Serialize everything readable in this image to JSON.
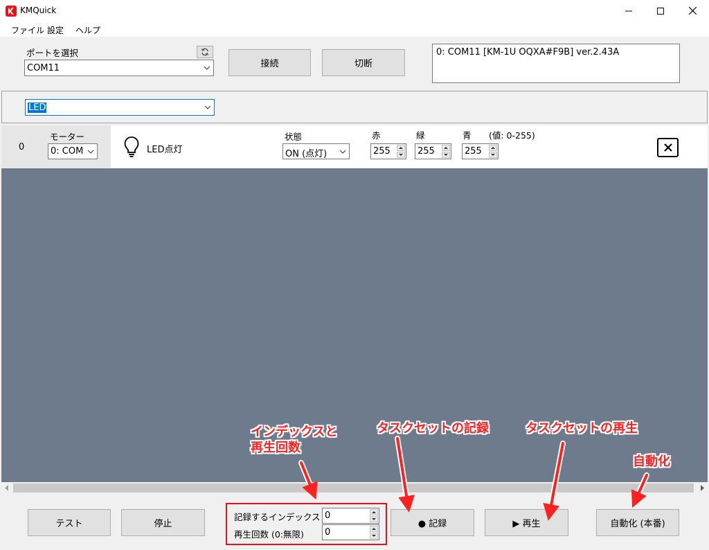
{
  "window": {
    "title": "KMQuick"
  },
  "menu": {
    "items": [
      "ファイル",
      "設定",
      "ヘルプ"
    ]
  },
  "port": {
    "label": "ポートを選択",
    "selected": "COM11",
    "connect_label": "接続",
    "disconnect_label": "切断"
  },
  "device_info": "0: COM11 [KM-1U OQXA#F9B] ver.2.43A",
  "task_type": {
    "selected": "LED"
  },
  "task_row": {
    "index": "0",
    "motor_label": "モーター",
    "motor_value": "0: COM",
    "action_label": "LED点灯",
    "state_label": "状態",
    "state_value": "ON (点灯)",
    "red_label": "赤",
    "green_label": "緑",
    "blue_label": "青",
    "range_note": "(値: 0-255)",
    "red_value": "255",
    "green_value": "255",
    "blue_value": "255"
  },
  "bottom": {
    "test_label": "テスト",
    "stop_label": "停止",
    "record_index_label": "記録するインデックス",
    "record_index_value": "0",
    "repeat_label": "再生回数 (0:無限)",
    "repeat_value": "0",
    "record_label": "● 記録",
    "play_label": "▶ 再生",
    "auto_label": "自動化 (本番)"
  },
  "annotations": {
    "index_line1": "インデックスと",
    "index_line2": "再生回数",
    "record": "タスクセットの記録",
    "play": "タスクセットの再生",
    "auto": "自動化"
  },
  "colors": {
    "task_area_bg": "#6d7b8d",
    "selection": "#0078d7",
    "annotation_red": "#ff2020",
    "app_icon_red": "#e8111a"
  },
  "icons": [
    "app-logo-icon",
    "minimize-icon",
    "maximize-icon",
    "close-icon",
    "refresh-icon",
    "chevron-down-icon",
    "light-bulb-icon",
    "delete-x-icon"
  ]
}
